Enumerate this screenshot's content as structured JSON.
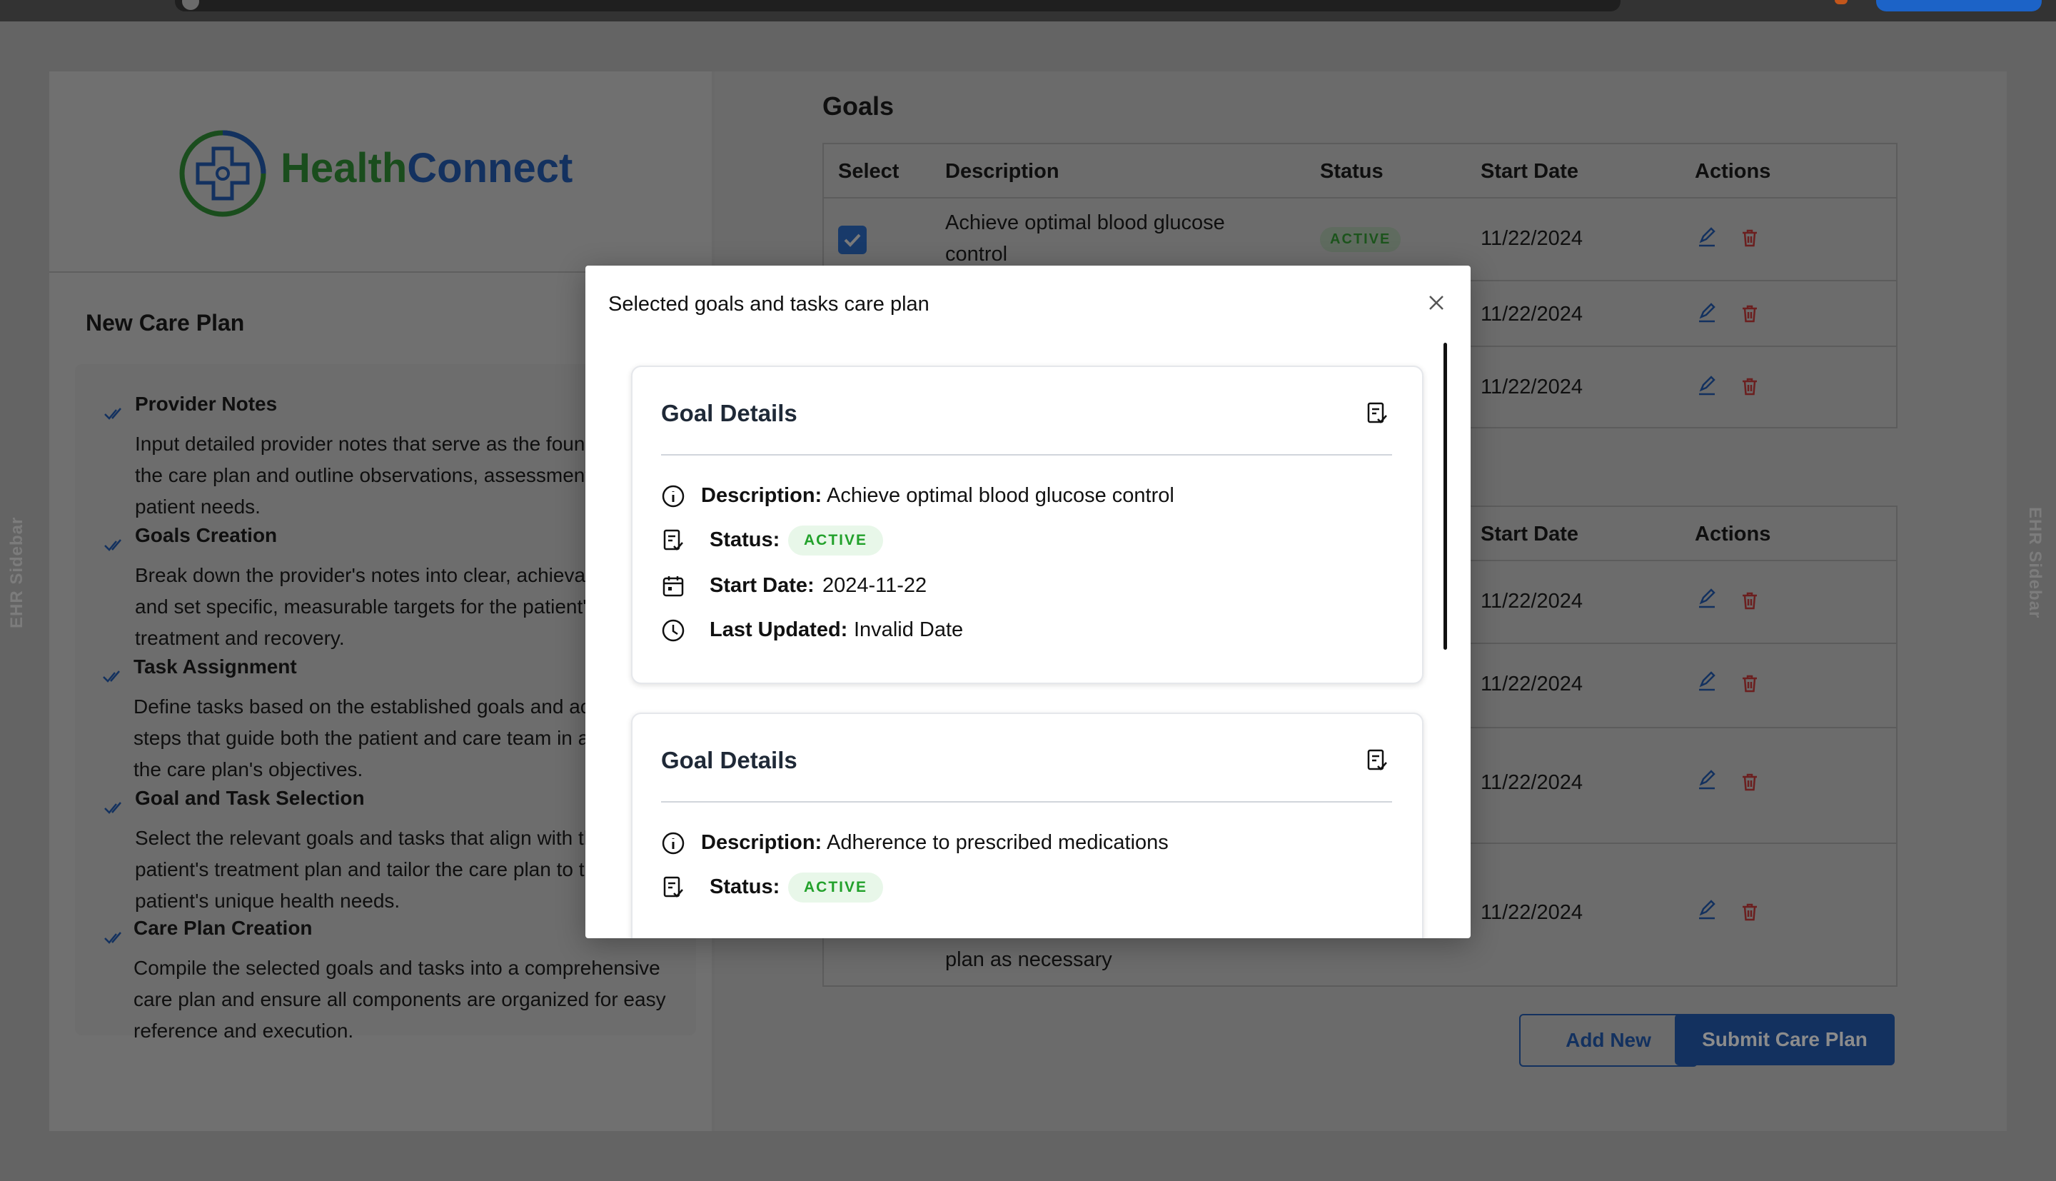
{
  "sidebar_labels": {
    "left": "EHR Sidebar",
    "right": "EHR Sidebar"
  },
  "logo": {
    "part1": "Health",
    "part2": "Connect"
  },
  "care_plan": {
    "title": "New Care Plan",
    "steps": [
      {
        "title": "Provider Notes",
        "text": "Input detailed provider notes that serve as the foundation for the care plan and outline observations, assessments, and patient needs."
      },
      {
        "title": "Goals Creation",
        "text": "Break down the provider's notes into clear, achievable goals and set specific, measurable targets for the patient's treatment and recovery."
      },
      {
        "title": "Task Assignment",
        "text": "Define tasks based on the established goals and actionable steps that guide both the patient and care team in achieving the care plan's objectives."
      },
      {
        "title": "Goal and Task Selection",
        "text": "Select the relevant goals and tasks that align with the patient's treatment plan and tailor the care plan to the patient's unique health needs."
      },
      {
        "title": "Care Plan Creation",
        "text": "Compile the selected goals and tasks into a comprehensive care plan and ensure all components are organized for easy reference and execution."
      }
    ]
  },
  "goals": {
    "title": "Goals",
    "headers": {
      "select": "Select",
      "description": "Description",
      "status": "Status",
      "start_date": "Start Date",
      "actions": "Actions"
    },
    "rows": [
      {
        "description": "Achieve optimal blood glucose control",
        "status": "ACTIVE",
        "start_date": "11/22/2024"
      },
      {
        "start_date": "11/22/2024"
      },
      {
        "start_date": "11/22/2024"
      }
    ]
  },
  "tasks": {
    "headers": {
      "start_date": "Start Date",
      "actions": "Actions"
    },
    "rows": [
      {
        "start_date": "11/22/2024"
      },
      {
        "start_date": "11/22/2024"
      },
      {
        "start_date": "11/22/2024"
      },
      {
        "start_date": "11/22/2024",
        "description_tail": "plan as necessary"
      }
    ]
  },
  "buttons": {
    "add_new": "Add New",
    "submit": "Submit Care Plan"
  },
  "modal": {
    "title": "Selected goals and tasks care plan",
    "cards": [
      {
        "title": "Goal Details",
        "description_label": "Description:",
        "description": "Achieve optimal blood glucose control",
        "status_label": "Status:",
        "status": "ACTIVE",
        "start_date_label": "Start Date:",
        "start_date": "2024-11-22",
        "last_updated_label": "Last Updated:",
        "last_updated": "Invalid Date"
      },
      {
        "title": "Goal Details",
        "description_label": "Description:",
        "description": "Adherence to prescribed medications",
        "status_label": "Status:",
        "status": "ACTIVE"
      }
    ]
  },
  "colors": {
    "brand_green": "#2e7d32",
    "brand_blue": "#1e4e9a",
    "active_green": "#22a12b",
    "delete_red": "#d32f2f"
  }
}
